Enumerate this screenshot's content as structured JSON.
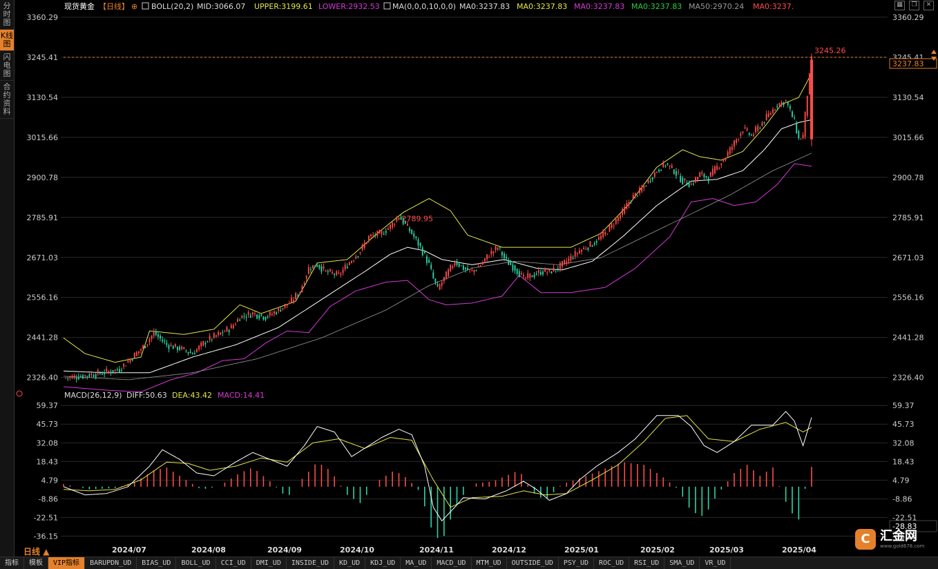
{
  "left_tabs": [
    "分时图",
    "K线图",
    "闪电图",
    "合约资料"
  ],
  "left_tab_active": 1,
  "header": {
    "instrument": "现货黄金",
    "period_tag": "【日线】",
    "boll_name": "BOLL(20,2)",
    "mid": "MID:3066.07",
    "upper": "UPPER:3199.61",
    "lower": "LOWER:2932.53",
    "ma_name": "MA(0,0,0,10,0,0)",
    "ma_a": "MA0:3237.83",
    "ma_b": "MA0:3237.83",
    "ma_c": "MA0:3237.83",
    "ma_d": "MA0:3237.83",
    "ma50": "MA50:2970.24",
    "ma_e": "MA0:3237."
  },
  "macd_header": {
    "name": "MACD(26,12,9)",
    "diff": "DIFF:50.63",
    "dea": "DEA:43.42",
    "macd": "MACD:14.41"
  },
  "period_label": "日线",
  "bottom_tabs": [
    "指标",
    "模板",
    "VIP指标",
    "BARUPDN_UD",
    "BIAS_UD",
    "BOLL_UD",
    "CCI_UD",
    "DMI_UD",
    "INSIDE_UD",
    "KD_UD",
    "KDJ_UD",
    "MA_UD",
    "MACD_UD",
    "MTM_UD",
    "OUTSIDE_UD",
    "PSY_UD",
    "ROC_UD",
    "RSI_UD",
    "SMA_UD",
    "VR_UD"
  ],
  "bottom_tab_active": 2,
  "logo": {
    "name": "汇金网",
    "url": "www.gold678.com",
    "mark": "C"
  },
  "colors": {
    "up": "#ff4b4b",
    "down": "#2bd6a6",
    "boll": "#e6e64a",
    "mid": "#ffffff",
    "lower": "#d63ad6",
    "ma50": "#9a9a9a",
    "accent": "#e5812a",
    "grid": "#2a2a2a"
  },
  "chart_data": [
    {
      "type": "candlestick",
      "title": "现货黄金 日线",
      "y_ticks": [
        "3360.29",
        "3245.41",
        "3130.54",
        "3015.66",
        "2900.78",
        "2785.91",
        "2671.03",
        "2556.16",
        "2441.28",
        "2326.40"
      ],
      "ylim": [
        2300,
        3370
      ],
      "x_ticks": [
        "2024/07",
        "2024/08",
        "2024/09",
        "2024/10",
        "2024/11",
        "2024/12",
        "2025/01",
        "2025/02",
        "2025/03",
        "2025/04"
      ],
      "annotations": [
        {
          "text": "2789.95",
          "value": 2789.95
        },
        {
          "text": "3245.26",
          "value": 3245.26
        }
      ],
      "last_price": "3237.83",
      "close_path": [
        [
          0,
          2325
        ],
        [
          8,
          2330
        ],
        [
          18,
          2340
        ],
        [
          26,
          2350
        ],
        [
          32,
          2385
        ],
        [
          38,
          2420
        ],
        [
          42,
          2455
        ],
        [
          48,
          2420
        ],
        [
          54,
          2410
        ],
        [
          60,
          2395
        ],
        [
          66,
          2430
        ],
        [
          72,
          2450
        ],
        [
          78,
          2470
        ],
        [
          82,
          2500
        ],
        [
          88,
          2510
        ],
        [
          94,
          2500
        ],
        [
          100,
          2520
        ],
        [
          106,
          2545
        ],
        [
          110,
          2575
        ],
        [
          114,
          2640
        ],
        [
          118,
          2650
        ],
        [
          122,
          2630
        ],
        [
          128,
          2620
        ],
        [
          132,
          2650
        ],
        [
          138,
          2690
        ],
        [
          142,
          2730
        ],
        [
          148,
          2740
        ],
        [
          152,
          2760
        ],
        [
          156,
          2789
        ],
        [
          162,
          2740
        ],
        [
          166,
          2700
        ],
        [
          170,
          2650
        ],
        [
          172,
          2610
        ],
        [
          174,
          2580
        ],
        [
          178,
          2620
        ],
        [
          182,
          2660
        ],
        [
          186,
          2640
        ],
        [
          190,
          2630
        ],
        [
          194,
          2650
        ],
        [
          198,
          2680
        ],
        [
          202,
          2700
        ],
        [
          206,
          2660
        ],
        [
          210,
          2640
        ],
        [
          214,
          2610
        ],
        [
          218,
          2620
        ],
        [
          222,
          2630
        ],
        [
          226,
          2630
        ],
        [
          230,
          2640
        ],
        [
          234,
          2660
        ],
        [
          240,
          2690
        ],
        [
          246,
          2710
        ],
        [
          252,
          2740
        ],
        [
          256,
          2770
        ],
        [
          260,
          2800
        ],
        [
          264,
          2840
        ],
        [
          268,
          2860
        ],
        [
          272,
          2890
        ],
        [
          276,
          2920
        ],
        [
          280,
          2940
        ],
        [
          284,
          2920
        ],
        [
          288,
          2890
        ],
        [
          292,
          2880
        ],
        [
          296,
          2910
        ],
        [
          300,
          2900
        ],
        [
          304,
          2930
        ],
        [
          308,
          2960
        ],
        [
          312,
          3000
        ],
        [
          316,
          3040
        ],
        [
          320,
          3020
        ],
        [
          324,
          3050
        ],
        [
          328,
          3080
        ],
        [
          332,
          3110
        ],
        [
          336,
          3120
        ],
        [
          340,
          3060
        ],
        [
          342,
          3010
        ],
        [
          344,
          3020
        ],
        [
          346,
          3140
        ],
        [
          348,
          3237.83
        ]
      ],
      "mid_path": [
        [
          0,
          2345
        ],
        [
          20,
          2340
        ],
        [
          40,
          2340
        ],
        [
          60,
          2385
        ],
        [
          80,
          2420
        ],
        [
          100,
          2470
        ],
        [
          120,
          2550
        ],
        [
          140,
          2630
        ],
        [
          152,
          2680
        ],
        [
          160,
          2700
        ],
        [
          168,
          2690
        ],
        [
          176,
          2665
        ],
        [
          190,
          2650
        ],
        [
          205,
          2665
        ],
        [
          220,
          2640
        ],
        [
          232,
          2635
        ],
        [
          246,
          2660
        ],
        [
          260,
          2730
        ],
        [
          276,
          2820
        ],
        [
          292,
          2890
        ],
        [
          304,
          2895
        ],
        [
          316,
          2920
        ],
        [
          326,
          2980
        ],
        [
          334,
          3040
        ],
        [
          342,
          3058
        ],
        [
          348,
          3066.07
        ]
      ],
      "upper_path": [
        [
          0,
          2440
        ],
        [
          10,
          2395
        ],
        [
          24,
          2370
        ],
        [
          36,
          2385
        ],
        [
          40,
          2460
        ],
        [
          56,
          2450
        ],
        [
          70,
          2465
        ],
        [
          82,
          2535
        ],
        [
          92,
          2510
        ],
        [
          108,
          2545
        ],
        [
          118,
          2655
        ],
        [
          132,
          2665
        ],
        [
          146,
          2740
        ],
        [
          158,
          2800
        ],
        [
          170,
          2840
        ],
        [
          180,
          2805
        ],
        [
          188,
          2735
        ],
        [
          204,
          2700
        ],
        [
          216,
          2700
        ],
        [
          236,
          2700
        ],
        [
          250,
          2740
        ],
        [
          264,
          2830
        ],
        [
          276,
          2930
        ],
        [
          288,
          2980
        ],
        [
          296,
          2960
        ],
        [
          306,
          2950
        ],
        [
          316,
          2975
        ],
        [
          326,
          3045
        ],
        [
          334,
          3110
        ],
        [
          342,
          3130
        ],
        [
          348,
          3199.61
        ]
      ],
      "lower_path": [
        [
          0,
          2300
        ],
        [
          20,
          2290
        ],
        [
          36,
          2285
        ],
        [
          50,
          2320
        ],
        [
          62,
          2340
        ],
        [
          74,
          2375
        ],
        [
          84,
          2380
        ],
        [
          94,
          2425
        ],
        [
          104,
          2460
        ],
        [
          114,
          2455
        ],
        [
          124,
          2530
        ],
        [
          136,
          2575
        ],
        [
          150,
          2600
        ],
        [
          160,
          2605
        ],
        [
          170,
          2550
        ],
        [
          178,
          2535
        ],
        [
          190,
          2540
        ],
        [
          204,
          2560
        ],
        [
          212,
          2620
        ],
        [
          222,
          2570
        ],
        [
          236,
          2570
        ],
        [
          252,
          2585
        ],
        [
          266,
          2640
        ],
        [
          282,
          2730
        ],
        [
          292,
          2830
        ],
        [
          302,
          2840
        ],
        [
          312,
          2820
        ],
        [
          322,
          2830
        ],
        [
          332,
          2880
        ],
        [
          340,
          2940
        ],
        [
          348,
          2932.53
        ]
      ],
      "ma50_path": [
        [
          0,
          2330
        ],
        [
          30,
          2320
        ],
        [
          60,
          2340
        ],
        [
          90,
          2380
        ],
        [
          120,
          2440
        ],
        [
          150,
          2520
        ],
        [
          170,
          2590
        ],
        [
          190,
          2640
        ],
        [
          210,
          2660
        ],
        [
          230,
          2650
        ],
        [
          250,
          2670
        ],
        [
          270,
          2730
        ],
        [
          290,
          2790
        ],
        [
          310,
          2850
        ],
        [
          330,
          2920
        ],
        [
          348,
          2970.24
        ]
      ]
    },
    {
      "type": "macd",
      "title": "MACD(26,12,9)",
      "y_ticks": [
        "59.37",
        "45.73",
        "32.08",
        "18.43",
        "4.79",
        "-8.86",
        "-22.51",
        "-36.15"
      ],
      "ylim": [
        -43,
        62
      ],
      "current_label": "-28.83",
      "diff_path": [
        [
          0,
          0
        ],
        [
          10,
          -6
        ],
        [
          20,
          -5
        ],
        [
          30,
          0
        ],
        [
          40,
          15
        ],
        [
          46,
          27
        ],
        [
          54,
          20
        ],
        [
          62,
          10
        ],
        [
          70,
          8
        ],
        [
          80,
          18
        ],
        [
          88,
          25
        ],
        [
          96,
          20
        ],
        [
          104,
          15
        ],
        [
          112,
          30
        ],
        [
          118,
          44
        ],
        [
          126,
          40
        ],
        [
          134,
          22
        ],
        [
          140,
          28
        ],
        [
          148,
          36
        ],
        [
          156,
          42
        ],
        [
          162,
          38
        ],
        [
          168,
          15
        ],
        [
          172,
          -15
        ],
        [
          176,
          -25
        ],
        [
          182,
          -15
        ],
        [
          186,
          -8
        ],
        [
          196,
          -9
        ],
        [
          206,
          -3
        ],
        [
          214,
          4
        ],
        [
          220,
          -2
        ],
        [
          226,
          -10
        ],
        [
          234,
          -5
        ],
        [
          240,
          5
        ],
        [
          248,
          15
        ],
        [
          258,
          25
        ],
        [
          266,
          35
        ],
        [
          276,
          52
        ],
        [
          286,
          52
        ],
        [
          292,
          44
        ],
        [
          298,
          30
        ],
        [
          304,
          25
        ],
        [
          312,
          33
        ],
        [
          320,
          45
        ],
        [
          330,
          45
        ],
        [
          336,
          55
        ],
        [
          340,
          48
        ],
        [
          344,
          30
        ],
        [
          348,
          50.63
        ]
      ],
      "dea_path": [
        [
          0,
          -2
        ],
        [
          12,
          -3
        ],
        [
          24,
          -2
        ],
        [
          36,
          5
        ],
        [
          48,
          18
        ],
        [
          58,
          17
        ],
        [
          68,
          12
        ],
        [
          80,
          15
        ],
        [
          92,
          21
        ],
        [
          104,
          18
        ],
        [
          116,
          32
        ],
        [
          128,
          35
        ],
        [
          140,
          28
        ],
        [
          152,
          36
        ],
        [
          162,
          34
        ],
        [
          172,
          5
        ],
        [
          180,
          -15
        ],
        [
          190,
          -8
        ],
        [
          204,
          -7
        ],
        [
          214,
          -3
        ],
        [
          224,
          -6
        ],
        [
          234,
          -5
        ],
        [
          246,
          5
        ],
        [
          258,
          16
        ],
        [
          270,
          33
        ],
        [
          280,
          50
        ],
        [
          290,
          52
        ],
        [
          300,
          35
        ],
        [
          312,
          33
        ],
        [
          324,
          42
        ],
        [
          336,
          47
        ],
        [
          344,
          40
        ],
        [
          348,
          43.42
        ]
      ],
      "histogram_path": [
        [
          0,
          2
        ],
        [
          12,
          -2
        ],
        [
          24,
          -1
        ],
        [
          34,
          4
        ],
        [
          42,
          12
        ],
        [
          48,
          14
        ],
        [
          56,
          6
        ],
        [
          64,
          -2
        ],
        [
          72,
          0
        ],
        [
          82,
          10
        ],
        [
          88,
          14
        ],
        [
          96,
          4
        ],
        [
          104,
          -8
        ],
        [
          110,
          4
        ],
        [
          118,
          18
        ],
        [
          124,
          12
        ],
        [
          132,
          -6
        ],
        [
          138,
          -12
        ],
        [
          146,
          4
        ],
        [
          154,
          12
        ],
        [
          160,
          6
        ],
        [
          166,
          -4
        ],
        [
          172,
          -35
        ],
        [
          176,
          -40
        ],
        [
          180,
          -24
        ],
        [
          184,
          -10
        ],
        [
          190,
          2
        ],
        [
          200,
          4
        ],
        [
          206,
          8
        ],
        [
          212,
          12
        ],
        [
          218,
          -4
        ],
        [
          224,
          -10
        ],
        [
          232,
          2
        ],
        [
          240,
          6
        ],
        [
          250,
          12
        ],
        [
          260,
          18
        ],
        [
          270,
          16
        ],
        [
          278,
          8
        ],
        [
          286,
          -2
        ],
        [
          292,
          -18
        ],
        [
          298,
          -22
        ],
        [
          304,
          -6
        ],
        [
          312,
          10
        ],
        [
          318,
          16
        ],
        [
          324,
          8
        ],
        [
          330,
          14
        ],
        [
          334,
          -4
        ],
        [
          338,
          -18
        ],
        [
          342,
          -24
        ],
        [
          346,
          6
        ],
        [
          348,
          14.41
        ]
      ]
    }
  ]
}
